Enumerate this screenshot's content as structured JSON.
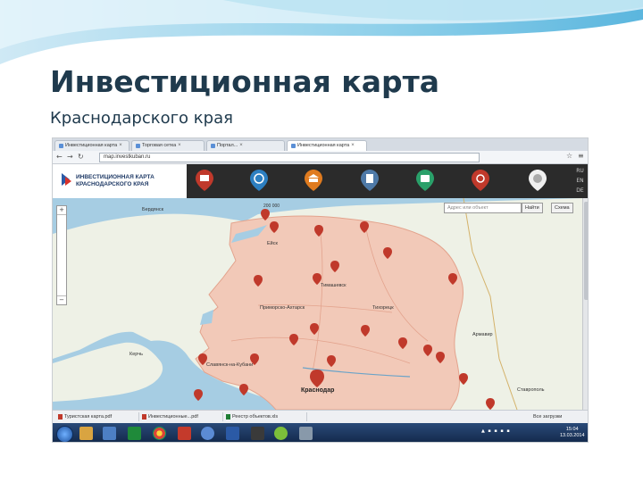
{
  "slide": {
    "title": "Инвестиционная карта",
    "subtitle": "Краснодарского края"
  },
  "browser": {
    "tabs": [
      {
        "label": "Инвестиционная карта",
        "active": false
      },
      {
        "label": "Торговая сетка",
        "active": false
      },
      {
        "label": "Портал...",
        "active": false
      },
      {
        "label": "Инвестиционная карта",
        "active": true
      }
    ],
    "url": "map.investkuban.ru"
  },
  "site": {
    "logo_line1": "ИНВЕСТИЦИОННАЯ КАРТА",
    "logo_line2": "КРАСНОДАРСКОГО КРАЯ",
    "category_colors": [
      "#c0392b",
      "#2d7fc1",
      "#e07b1f",
      "#4f7aa8",
      "#2aa06a",
      "#c0392b",
      "#f0f0f0"
    ]
  },
  "map": {
    "scale_label": "200 000",
    "search_placeholder": "Адрес или объект",
    "find_label": "Найти",
    "layers_label": "Схема",
    "zoom_in": "+",
    "zoom_out": "−",
    "cities": {
      "berdyansk": "Бердянск",
      "timashevsk": "Тимашевск",
      "slavyansk": "Славянск-на-Кубани",
      "krasnodar": "Краснодар",
      "tikhoretsk": "Тихорецк",
      "primorsko": "Приморско-Ахтарск",
      "kerch": "Керчь",
      "armavir": "Армавир",
      "stavropol": "Ставрополь",
      "eysk": "Ейск"
    },
    "land_color": "#f2c9b8",
    "sea_color": "#a6cde3",
    "marker_color": "#c0392b"
  },
  "downloads": {
    "items": [
      "Туристская карта.pdf",
      "Инвестиционные...pdf",
      "Реестр объектов.xls"
    ],
    "show_all": "Все загрузки"
  },
  "taskbar": {
    "time": "15:04",
    "date": "13.03.2014"
  }
}
